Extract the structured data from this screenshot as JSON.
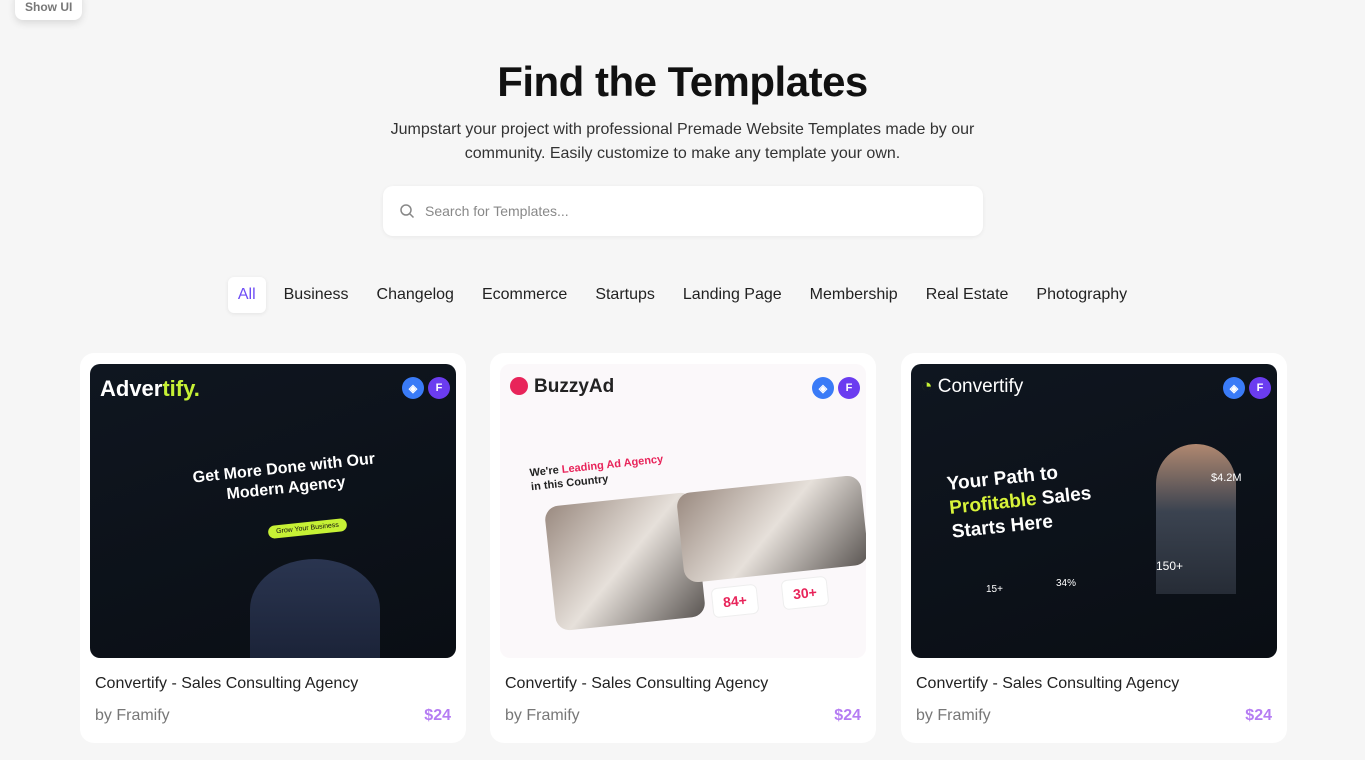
{
  "show_ui": "Show UI",
  "header": {
    "title": "Find the Templates",
    "subtitle": "Jumpstart your project with professional Premade Website Templates made by our community. Easily customize to make any template your own."
  },
  "search": {
    "placeholder": "Search for Templates...",
    "value": ""
  },
  "tabs": [
    {
      "label": "All",
      "active": true
    },
    {
      "label": "Business"
    },
    {
      "label": "Changelog"
    },
    {
      "label": "Ecommerce"
    },
    {
      "label": "Startups"
    },
    {
      "label": "Landing Page"
    },
    {
      "label": "Membership"
    },
    {
      "label": "Real Estate"
    },
    {
      "label": "Photography"
    }
  ],
  "accent": "#6d4cf5",
  "price_color": "#b57cf3",
  "cards": [
    {
      "title": "Convertify - Sales Consulting Agency",
      "author": "by Framify",
      "price": "$24",
      "preview": {
        "brand_a": "Adver",
        "brand_b": "tify.",
        "headline": "Get More Done with Our Modern Agency",
        "cta": "Grow Your Business"
      }
    },
    {
      "title": "Convertify - Sales Consulting Agency",
      "author": "by Framify",
      "price": "$24",
      "preview": {
        "brand": "BuzzyAd",
        "headline_a": "We're ",
        "headline_b": "Leading Ad Agency",
        "headline_c": " in this Country",
        "stat1": "84+",
        "stat2": "30+"
      }
    },
    {
      "title": "Convertify - Sales Consulting Agency",
      "author": "by Framify",
      "price": "$24",
      "preview": {
        "brand": "Convertify",
        "headline_a": "Your Path to",
        "headline_b": "Profitable",
        "headline_c": " Sales Starts Here",
        "stat1": "$4.2M",
        "stat2": "150+",
        "stat3": "15+",
        "stat4": "34%"
      }
    }
  ]
}
